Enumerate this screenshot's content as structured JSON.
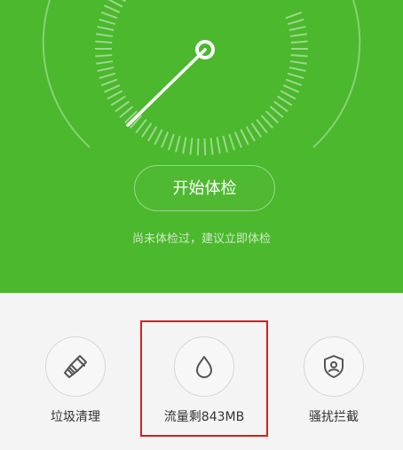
{
  "header": {
    "start_button_label": "开始体检",
    "hint_text": "尚未体检过，建议立即体检",
    "bg_color": "#4bb82d"
  },
  "tools": [
    {
      "label": "垃圾清理",
      "icon": "broom-icon"
    },
    {
      "label": "流量剩843MB",
      "icon": "water-drop-icon"
    },
    {
      "label": "骚扰拦截",
      "icon": "shield-user-icon"
    }
  ],
  "highlight_color": "#e01a1a"
}
